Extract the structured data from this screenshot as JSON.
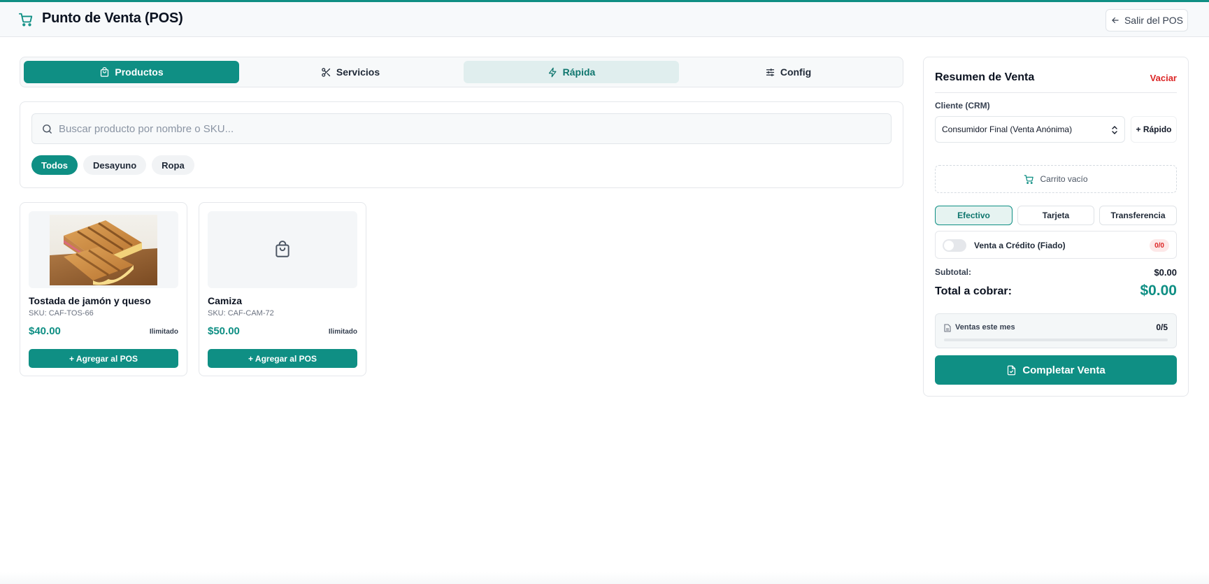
{
  "header": {
    "title": "Punto de Venta (POS)",
    "exit_label": "Salir del POS"
  },
  "tabs": [
    {
      "label": "Productos",
      "icon": "bag-icon",
      "state": "active"
    },
    {
      "label": "Servicios",
      "icon": "scissors-icon",
      "state": "normal"
    },
    {
      "label": "Rápida",
      "icon": "bolt-icon",
      "state": "hover"
    },
    {
      "label": "Config",
      "icon": "sliders-icon",
      "state": "normal"
    }
  ],
  "search": {
    "placeholder": "Buscar producto por nombre o SKU...",
    "value": ""
  },
  "categories": [
    {
      "label": "Todos",
      "active": true
    },
    {
      "label": "Desayuno",
      "active": false
    },
    {
      "label": "Ropa",
      "active": false
    }
  ],
  "products": [
    {
      "name": "Tostada de jamón y queso",
      "sku": "SKU: CAF-TOS-66",
      "price": "$40.00",
      "stock": "Ilimitado",
      "add_label": "+ Agregar al POS",
      "image": "sandwich-photo"
    },
    {
      "name": "Camiza",
      "sku": "SKU: CAF-CAM-72",
      "price": "$50.00",
      "stock": "Ilimitado",
      "add_label": "+ Agregar al POS",
      "image": "bag-placeholder-icon"
    }
  ],
  "summary": {
    "title": "Resumen de Venta",
    "clear_label": "Vaciar",
    "client_label": "Cliente (CRM)",
    "client_selected": "Consumidor Final (Venta Anónima)",
    "quick_label": "+ Rápido",
    "empty_cart": "Carrito vacío",
    "payment_methods": [
      {
        "label": "Efectivo",
        "active": true
      },
      {
        "label": "Tarjeta",
        "active": false
      },
      {
        "label": "Transferencia",
        "active": false
      }
    ],
    "credit_label": "Venta a Crédito (Fiado)",
    "credit_badge": "0/0",
    "credit_enabled": false,
    "subtotal_label": "Subtotal:",
    "subtotal_value": "$0.00",
    "total_label": "Total a cobrar:",
    "total_value": "$0.00",
    "month_label": "Ventas este mes",
    "month_value": "0/5",
    "month_progress": 0,
    "complete_label": "Completar Venta"
  },
  "colors": {
    "primary": "#0f8f84",
    "danger": "#dc2626",
    "tab_hover": "#e0eeee"
  }
}
